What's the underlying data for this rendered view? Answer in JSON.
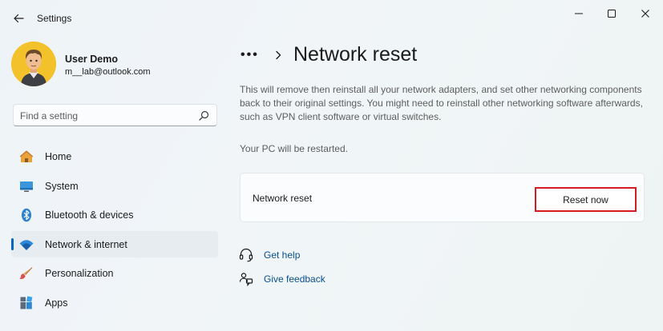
{
  "app": {
    "title": "Settings"
  },
  "user": {
    "name": "User Demo",
    "email": "m__lab@outlook.com"
  },
  "search": {
    "placeholder": "Find a setting"
  },
  "sidebar": {
    "items": [
      {
        "label": "Home",
        "icon": "home-icon"
      },
      {
        "label": "System",
        "icon": "system-icon"
      },
      {
        "label": "Bluetooth & devices",
        "icon": "bluetooth-icon"
      },
      {
        "label": "Network & internet",
        "icon": "wifi-icon",
        "active": true
      },
      {
        "label": "Personalization",
        "icon": "brush-icon"
      },
      {
        "label": "Apps",
        "icon": "apps-icon"
      }
    ]
  },
  "breadcrumb": {
    "more": "•••",
    "title": "Network reset"
  },
  "main": {
    "description": "This will remove then reinstall all your network adapters, and set other networking components back to their original settings. You might need to reinstall other networking software afterwards, such as VPN client software or virtual switches.",
    "restart_note": "Your PC will be restarted.",
    "card": {
      "label": "Network reset",
      "button": "Reset now"
    },
    "links": [
      {
        "label": "Get help",
        "icon": "help-icon"
      },
      {
        "label": "Give feedback",
        "icon": "feedback-icon"
      }
    ]
  },
  "colors": {
    "accent": "#0067c0",
    "highlight_border": "#d51c24",
    "link": "#0a4f94"
  }
}
